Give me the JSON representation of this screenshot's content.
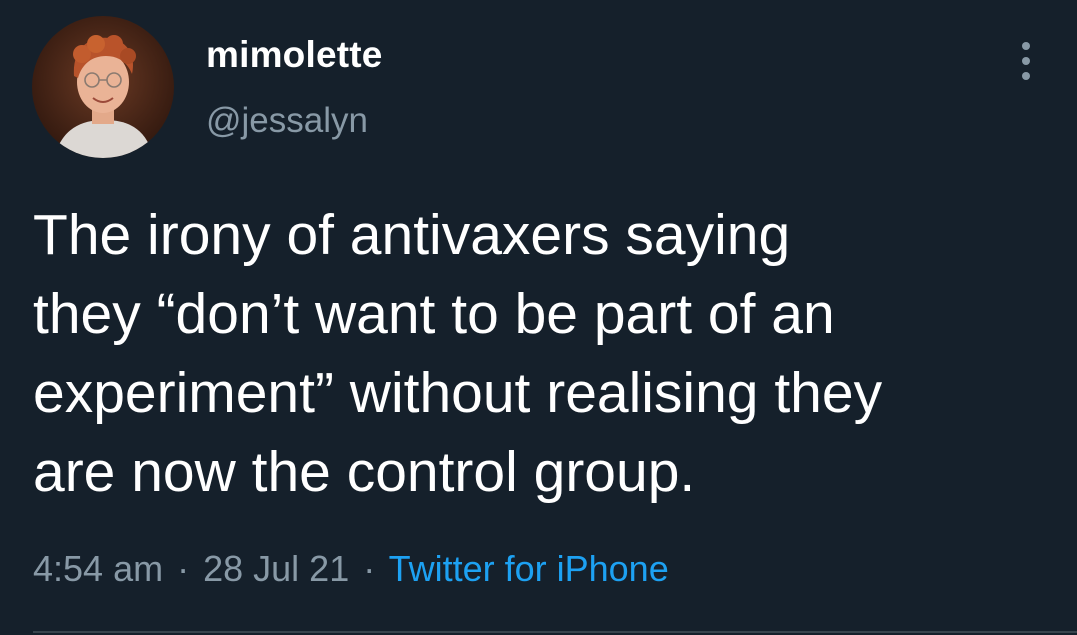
{
  "user": {
    "display_name": "mimolette",
    "handle": "@jessalyn",
    "avatar_icon": "profile-photo"
  },
  "tweet": {
    "text": "The irony of antivaxers saying\nthey “don’t want to be part of an\nexperiment” without realising they\nare now the control group.",
    "time": "4:54 am",
    "date": "28 Jul 21",
    "source": "Twitter for iPhone",
    "separator": "·"
  },
  "icons": {
    "more": "more-options-icon"
  },
  "colors": {
    "background": "#15202b",
    "primary_text": "#ffffff",
    "secondary_text": "#8899a6",
    "link": "#1da1f2",
    "divider": "#38444d"
  }
}
